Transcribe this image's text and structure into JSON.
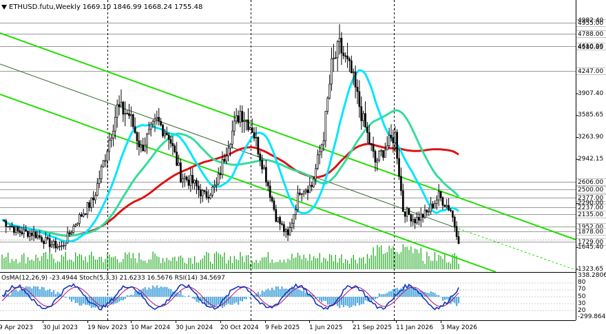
{
  "header": {
    "symbol": "ETHUSD.futu,Weekly",
    "open": "1669.10",
    "high": "1846.99",
    "low": "1668.24",
    "close": "1755.48"
  },
  "oscillator": {
    "label": "OsMA(12,26,9) -23.4944",
    "stoch": "Stoch(5,3,3) 21.6233 16.5676",
    "rsi": "RSI(14) 34.5697"
  },
  "colors": {
    "background": "#ffffff",
    "bull": "#000000",
    "bear": "#000000",
    "volume": "#22aa22",
    "ma_fast": "#00e5ff",
    "ma_mid": "#33dd99",
    "ma_slow": "#dd1111",
    "channel": "#22dd00",
    "trendline": "#336633",
    "osma": "#55aadd",
    "stoch_main": "#1133bb",
    "stoch_signal": "#aa1166",
    "grid": "#000000"
  },
  "price_axis": {
    "tagged": [
      "4955.00",
      "4788.00",
      "4610.00",
      "4247.00",
      "2606.00",
      "2500.00",
      "2377.00",
      "2237.00",
      "2135.00",
      "1952.00",
      "1878.00",
      "1729.00"
    ],
    "grid_labels": [
      "4982.40",
      "4580.85",
      "3907.40",
      "3585.65",
      "3263.90",
      "2942.15",
      "1645.40",
      "1323.65",
      "2290.00"
    ],
    "current": "1755.48"
  },
  "osc_axis": [
    "338.2806",
    "80",
    "70",
    "50",
    "30",
    "20",
    "-299.8646"
  ],
  "date_axis": [
    "9 Apr 2023",
    "30 Jul 2023",
    "19 Nov 2023",
    "10 Mar 2024",
    "30 Jun 2024",
    "20 Oct 2024",
    "9 Feb 2025",
    "1 Jun 2025",
    "21 Sep 2025",
    "11 Jan 2026",
    "3 May 2026"
  ],
  "chart_data": {
    "type": "candlestick",
    "timeframe": "Weekly",
    "y_range": [
      1323.65,
      4982.4
    ],
    "close_path": [
      {
        "t": 0,
        "c": 2050
      },
      {
        "t": 8,
        "c": 1880
      },
      {
        "t": 16,
        "c": 1850
      },
      {
        "t": 24,
        "c": 1700
      },
      {
        "t": 30,
        "c": 1650
      },
      {
        "t": 38,
        "c": 2050
      },
      {
        "t": 46,
        "c": 2350
      },
      {
        "t": 52,
        "c": 3000
      },
      {
        "t": 58,
        "c": 3700
      },
      {
        "t": 64,
        "c": 3600
      },
      {
        "t": 70,
        "c": 3100
      },
      {
        "t": 78,
        "c": 3500
      },
      {
        "t": 84,
        "c": 3300
      },
      {
        "t": 90,
        "c": 2700
      },
      {
        "t": 96,
        "c": 2600
      },
      {
        "t": 102,
        "c": 2400
      },
      {
        "t": 108,
        "c": 2550
      },
      {
        "t": 114,
        "c": 3200
      },
      {
        "t": 120,
        "c": 3650
      },
      {
        "t": 126,
        "c": 3400
      },
      {
        "t": 132,
        "c": 2800
      },
      {
        "t": 138,
        "c": 2100
      },
      {
        "t": 144,
        "c": 1800
      },
      {
        "t": 150,
        "c": 2500
      },
      {
        "t": 156,
        "c": 2550
      },
      {
        "t": 162,
        "c": 3300
      },
      {
        "t": 166,
        "c": 4300
      },
      {
        "t": 170,
        "c": 4600
      },
      {
        "t": 176,
        "c": 4200
      },
      {
        "t": 182,
        "c": 3500
      },
      {
        "t": 188,
        "c": 2900
      },
      {
        "t": 194,
        "c": 3150
      },
      {
        "t": 198,
        "c": 3300
      },
      {
        "t": 202,
        "c": 2200
      },
      {
        "t": 208,
        "c": 2050
      },
      {
        "t": 214,
        "c": 2150
      },
      {
        "t": 220,
        "c": 2400
      },
      {
        "t": 226,
        "c": 2200
      },
      {
        "t": 230,
        "c": 1755
      }
    ]
  }
}
